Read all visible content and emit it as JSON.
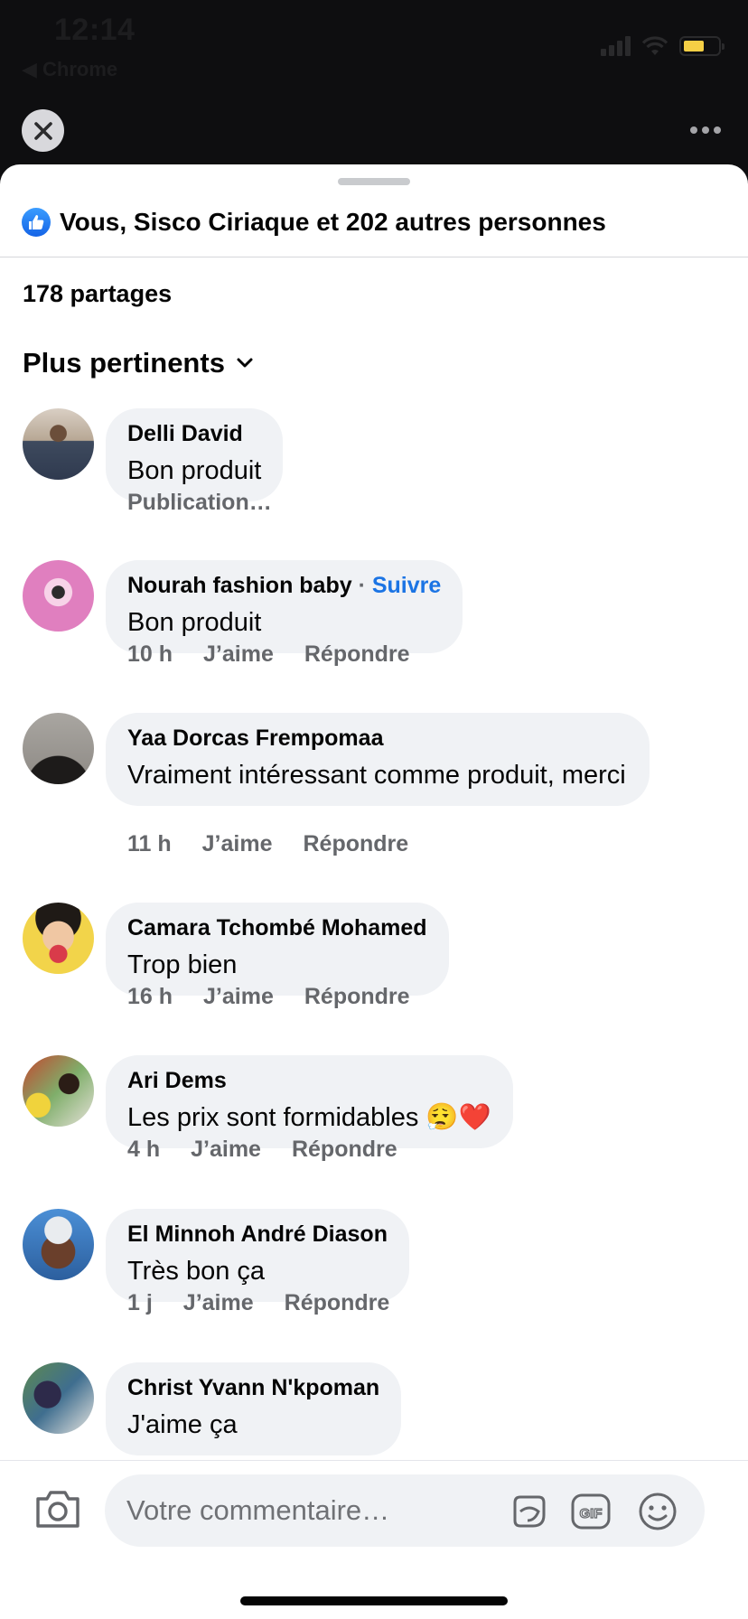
{
  "status_bar": {
    "time": "12:14",
    "back_app": "◀ Chrome"
  },
  "header": {
    "reactions_text": "Vous, Sisco Ciriaque et 202 autres personnes",
    "shares": "178 partages",
    "sort_label": "Plus pertinents"
  },
  "actions": {
    "like": "J’aime",
    "reply": "Répondre"
  },
  "comments": [
    {
      "author": "Delli David",
      "text": "Bon produit",
      "meta_text": "Publication…"
    },
    {
      "author": "Nourah fashion baby",
      "follow": "Suivre",
      "text": "Bon produit",
      "time": "10 h"
    },
    {
      "author": "Yaa Dorcas Frempomaa",
      "text": "Vraiment  intéressant comme produit, merci",
      "time": "11 h"
    },
    {
      "author": "Camara Tchombé Mohamed",
      "text": "Trop bien",
      "time": "16 h"
    },
    {
      "author": "Ari Dems",
      "text": "Les prix sont formidables 😮‍💨❤️",
      "time": "4 h"
    },
    {
      "author": "El Minnoh André Diason",
      "text": "Très bon ça",
      "time": "1 j"
    },
    {
      "author": "Christ Yvann N'kpoman",
      "text": "J'aime ça"
    }
  ],
  "composer": {
    "placeholder": "Votre commentaire…"
  },
  "colors": {
    "accent": "#1b74e4",
    "bubble": "#f0f2f5",
    "meta": "#65676b"
  },
  "icons": [
    "close-icon",
    "more-icon",
    "like-icon",
    "chevron-down-icon",
    "camera-icon",
    "sticker-icon",
    "gif-icon",
    "emoji-icon"
  ]
}
